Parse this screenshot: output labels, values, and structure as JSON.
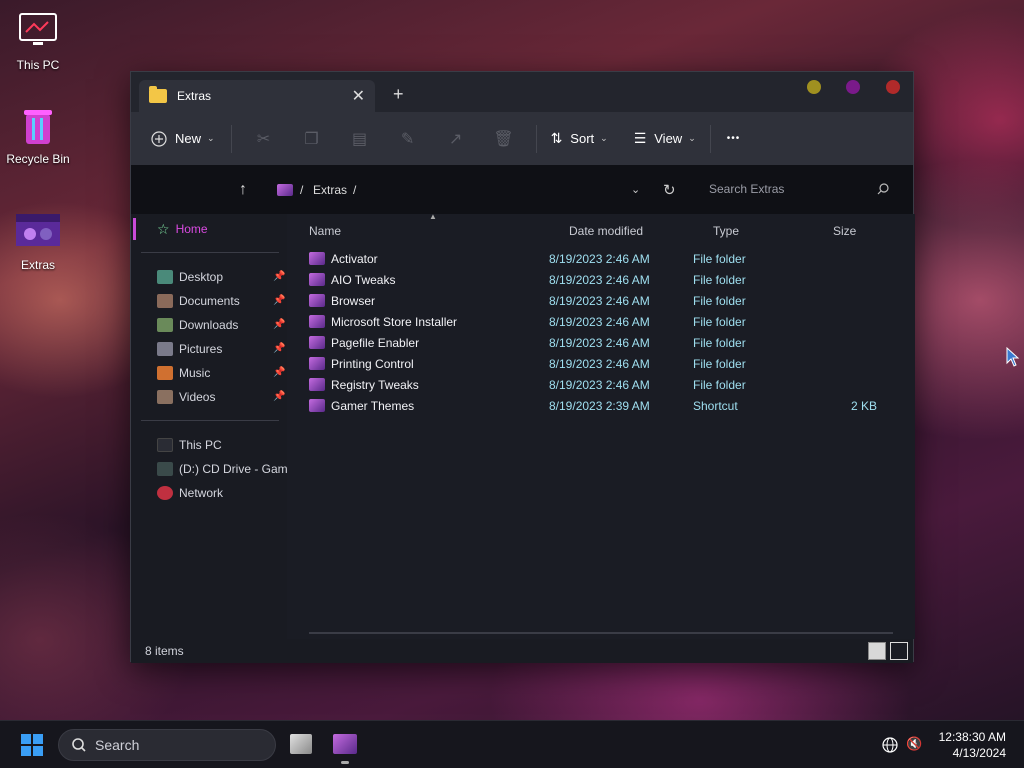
{
  "desktop": {
    "icons": [
      {
        "label": "This PC",
        "icon": "monitor-icon"
      },
      {
        "label": "Recycle Bin",
        "icon": "recycle-bin-icon"
      },
      {
        "label": "Extras",
        "icon": "fortnite-folder-icon"
      }
    ]
  },
  "window": {
    "tab_title": "Extras",
    "close_tab_glyph": "✕",
    "new_tab_glyph": "+",
    "title_dots": [
      {
        "name": "minimize",
        "color": "#a09020"
      },
      {
        "name": "maximize",
        "color": "#7a1a8a"
      },
      {
        "name": "close",
        "color": "#b02a2a"
      }
    ],
    "toolbar": {
      "new_label": "New",
      "sort_label": "Sort",
      "view_label": "View",
      "more_glyph": "•••",
      "icons": [
        "cut-icon",
        "copy-icon",
        "paste-icon",
        "rename-icon",
        "share-icon",
        "delete-icon"
      ]
    },
    "address": {
      "sep": "/",
      "crumb": "Extras",
      "search_placeholder": "Search Extras"
    },
    "nav": {
      "home": "Home",
      "quick_access": [
        {
          "label": "Desktop",
          "color": "#4a8a7a"
        },
        {
          "label": "Documents",
          "color": "#8a6a5a"
        },
        {
          "label": "Downloads",
          "color": "#6a8a5a"
        },
        {
          "label": "Pictures",
          "color": "#7a7a8a"
        },
        {
          "label": "Music",
          "color": "#d07030"
        },
        {
          "label": "Videos",
          "color": "#8a7060"
        }
      ],
      "this_pc": "This PC",
      "cd_drive": "(D:) CD Drive - Game",
      "network": "Network"
    },
    "columns": {
      "name": "Name",
      "date": "Date modified",
      "type": "Type",
      "size": "Size"
    },
    "files": [
      {
        "name": "Activator",
        "date": "8/19/2023 2:46 AM",
        "type": "File folder",
        "size": ""
      },
      {
        "name": "AIO Tweaks",
        "date": "8/19/2023 2:46 AM",
        "type": "File folder",
        "size": ""
      },
      {
        "name": "Browser",
        "date": "8/19/2023 2:46 AM",
        "type": "File folder",
        "size": ""
      },
      {
        "name": "Microsoft Store Installer",
        "date": "8/19/2023 2:46 AM",
        "type": "File folder",
        "size": ""
      },
      {
        "name": "Pagefile Enabler",
        "date": "8/19/2023 2:46 AM",
        "type": "File folder",
        "size": ""
      },
      {
        "name": "Printing Control",
        "date": "8/19/2023 2:46 AM",
        "type": "File folder",
        "size": ""
      },
      {
        "name": "Registry Tweaks",
        "date": "8/19/2023 2:46 AM",
        "type": "File folder",
        "size": ""
      },
      {
        "name": "Gamer Themes",
        "date": "8/19/2023 2:39 AM",
        "type": "Shortcut",
        "size": "2 KB"
      }
    ],
    "status": "8 items"
  },
  "taskbar": {
    "search_label": "Search",
    "time": "12:38:30 AM",
    "date": "4/13/2024"
  },
  "colors": {
    "accent": "#c84ad8",
    "link": "#9fdff0"
  }
}
